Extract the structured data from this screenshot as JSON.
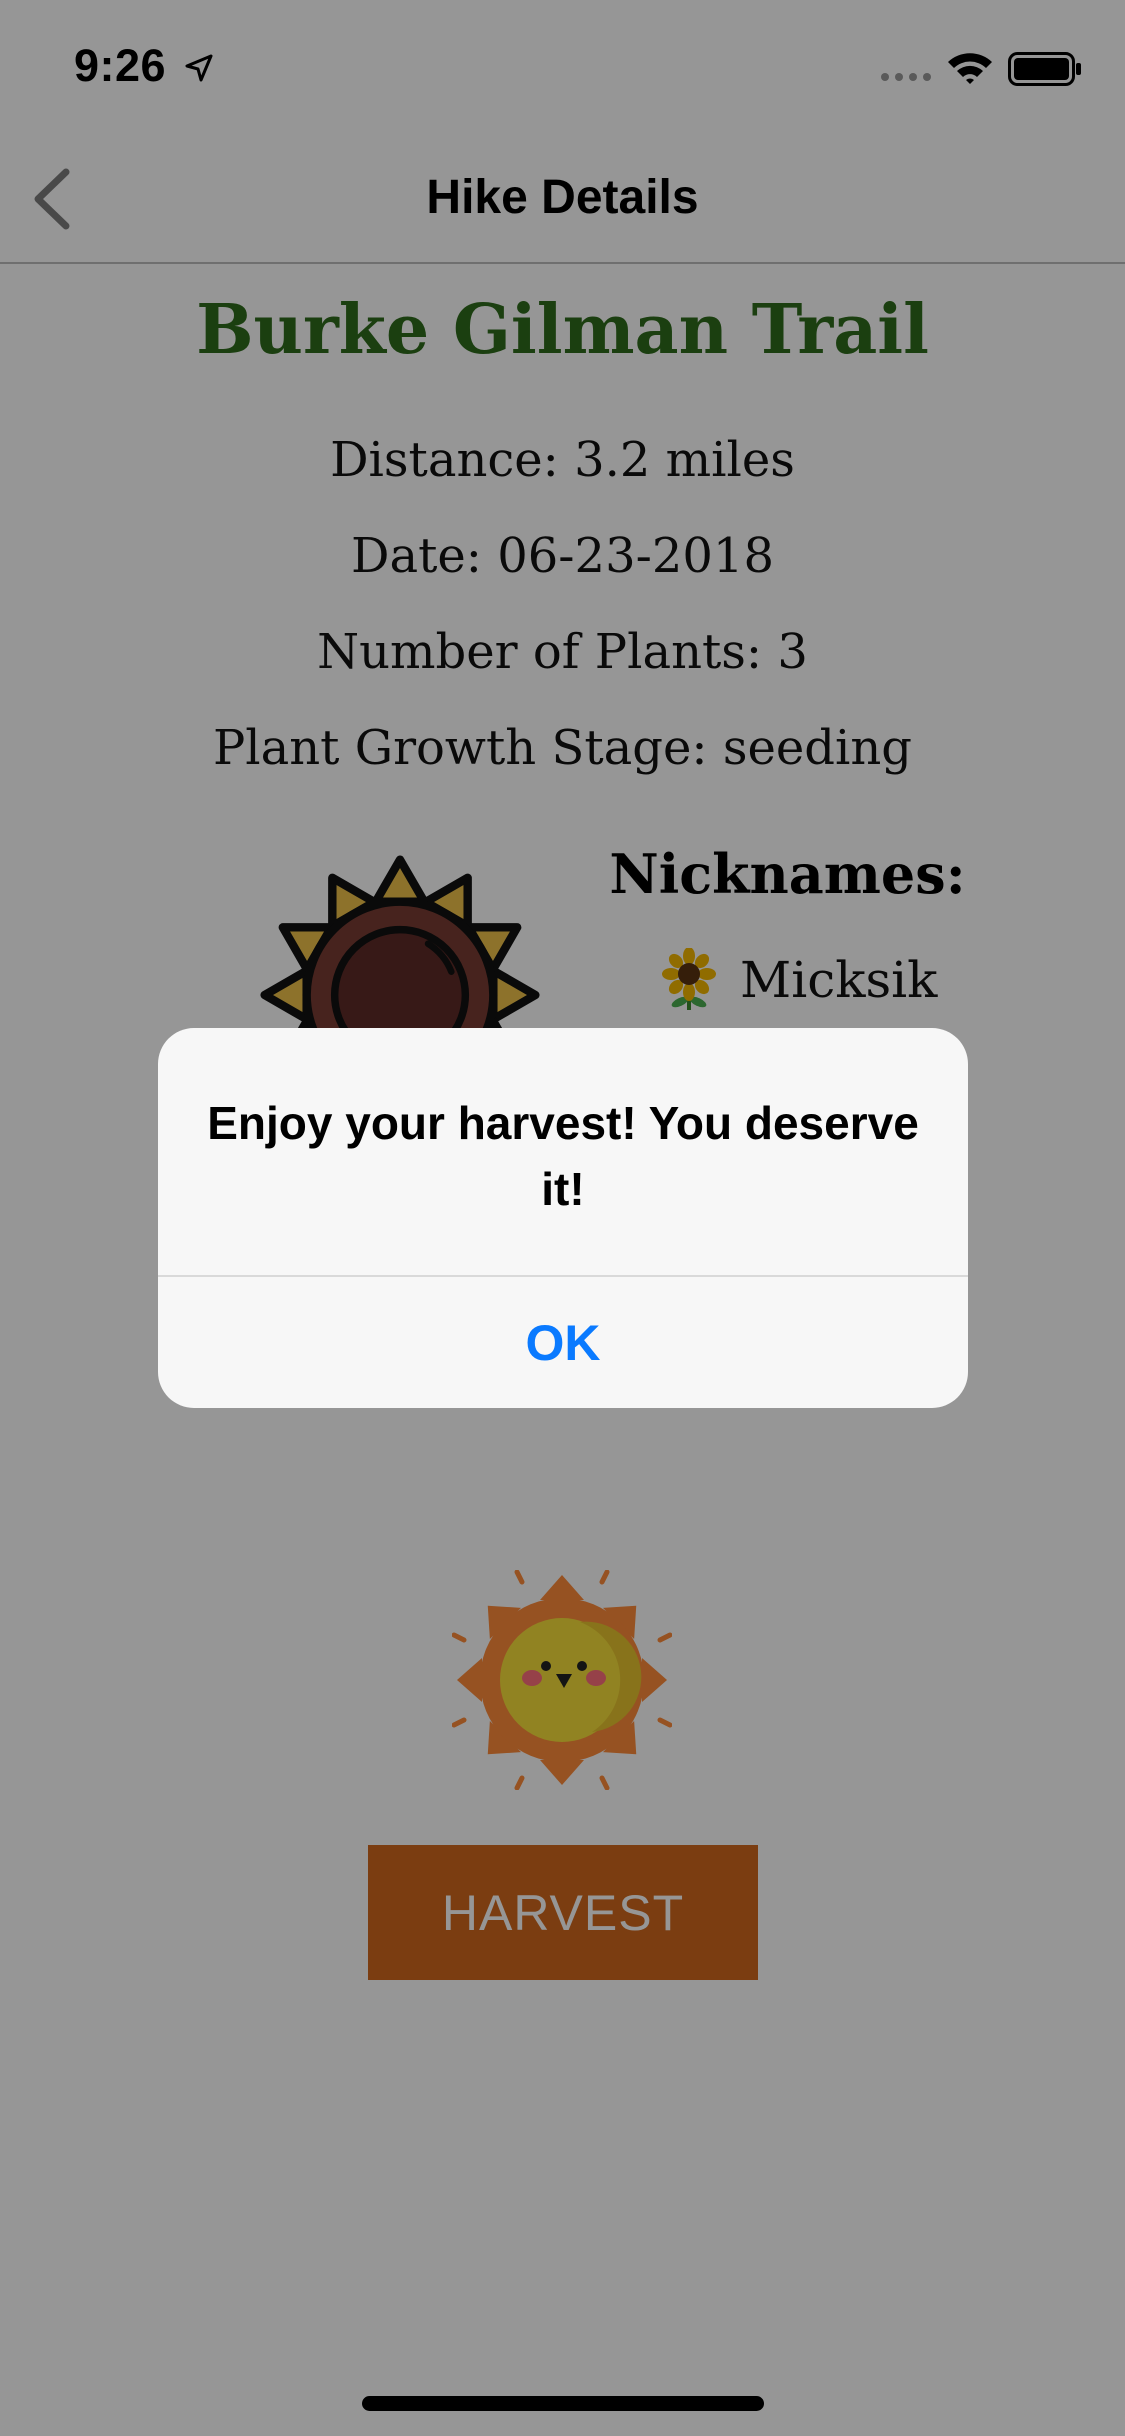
{
  "status_bar": {
    "time": "9:26"
  },
  "nav": {
    "title": "Hike Details"
  },
  "hike": {
    "name": "Burke Gilman Trail",
    "distance": "Distance: 3.2 miles",
    "date": "Date: 06-23-2018",
    "plants": "Number of Plants: 3",
    "stage": "Plant Growth Stage: seeding"
  },
  "nicknames": {
    "heading": "Nicknames:",
    "items": [
      {
        "icon": "sunflower-icon",
        "label": "Micksik"
      }
    ]
  },
  "harvest_button": {
    "label": "HARVEST"
  },
  "alert": {
    "message": "Enjoy your harvest! You deserve it!",
    "ok_label": "OK"
  },
  "colors": {
    "title_green": "#2f6b1c",
    "harvest_orange": "#d2691e",
    "ios_blue": "#0a7aff"
  }
}
